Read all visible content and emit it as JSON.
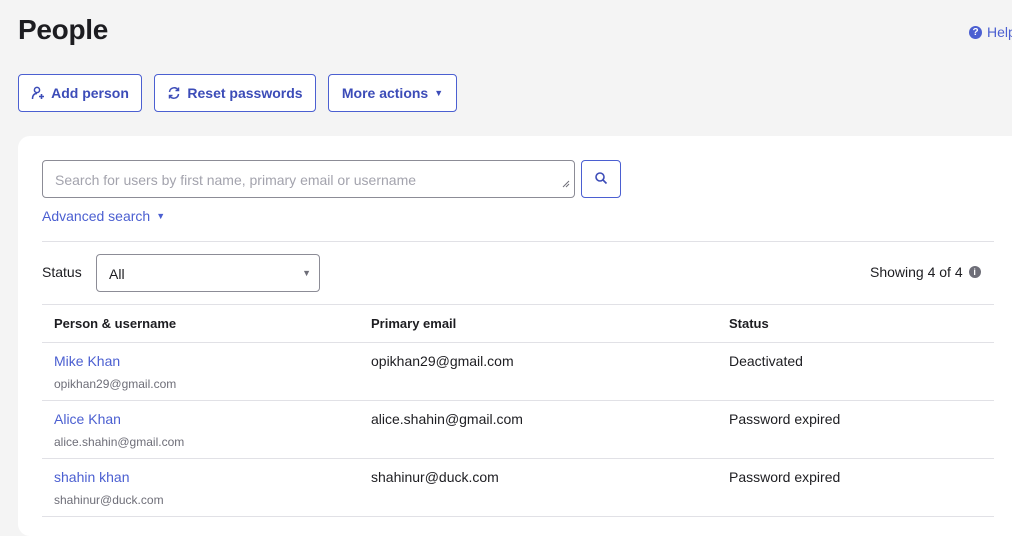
{
  "header": {
    "title": "People",
    "help_label": "Help"
  },
  "toolbar": {
    "add_person_label": "Add person",
    "reset_passwords_label": "Reset passwords",
    "more_actions_label": "More actions"
  },
  "search": {
    "placeholder": "Search for users by first name, primary email or username",
    "value": "",
    "advanced_label": "Advanced search"
  },
  "filter": {
    "status_label": "Status",
    "status_value": "All",
    "showing_text": "Showing 4 of 4"
  },
  "table": {
    "columns": [
      "Person & username",
      "Primary email",
      "Status"
    ],
    "rows": [
      {
        "name": "Mike Khan",
        "username": "opikhan29@gmail.com",
        "email": "opikhan29@gmail.com",
        "status": "Deactivated"
      },
      {
        "name": "Alice Khan",
        "username": "alice.shahin@gmail.com",
        "email": "alice.shahin@gmail.com",
        "status": "Password expired"
      },
      {
        "name": "shahin khan",
        "username": "shahinur@duck.com",
        "email": "shahinur@duck.com",
        "status": "Password expired"
      }
    ]
  },
  "icons": {
    "add_person": "add-person-icon",
    "reset": "refresh-icon",
    "more_actions": "caret-down-icon",
    "search": "search-icon",
    "help": "help-icon",
    "info": "info-icon"
  },
  "colors": {
    "accent": "#4b5fd1",
    "background": "#f4f4f4",
    "card": "#ffffff"
  }
}
